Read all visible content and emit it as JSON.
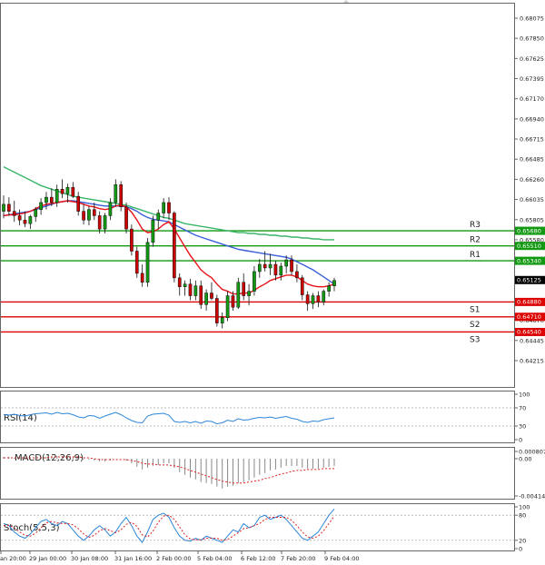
{
  "main": {
    "price_ticks": [
      "0.68075",
      "0.67850",
      "0.67625",
      "0.67395",
      "0.67170",
      "0.66940",
      "0.66715",
      "0.66485",
      "0.66260",
      "0.66035",
      "0.65805",
      "0.65580",
      "0.65350",
      "0.65125",
      "0.64900",
      "0.64670",
      "0.64445",
      "0.64215"
    ],
    "ylim": [
      0.64215,
      0.68075
    ],
    "current_price": "0.65125",
    "levels": [
      {
        "name": "R3",
        "value": 0.6568,
        "tag": "0.65680",
        "color": "#119911"
      },
      {
        "name": "R2",
        "value": 0.6551,
        "tag": "0.65510",
        "color": "#119911"
      },
      {
        "name": "R1",
        "value": 0.6534,
        "tag": "0.65340",
        "color": "#119911"
      },
      {
        "name": "S1",
        "value": 0.6488,
        "tag": "0.64880",
        "color": "#dd0000"
      },
      {
        "name": "S2",
        "value": 0.6471,
        "tag": "0.64710",
        "color": "#dd0000"
      },
      {
        "name": "S3",
        "value": 0.6454,
        "tag": "0.64540",
        "color": "#dd0000"
      }
    ],
    "colors": {
      "up": "#119911",
      "down": "#cc0000",
      "ma_fast": "#e8141a",
      "ma_mid": "#3a5fd8",
      "ma_slow": "#3ab56a",
      "current_tag": "#000000"
    }
  },
  "rsi": {
    "label": "RSI(14)",
    "ticks": [
      "100",
      "70",
      "30",
      "0"
    ],
    "line_color": "#2e86d9"
  },
  "macd": {
    "label": "MACD(12,26,9)",
    "ticks": [
      "0.000807",
      "0.00",
      "-0.004142"
    ],
    "hist_color": "#888888",
    "signal_color": "#dd2222"
  },
  "stoch": {
    "label": "Stoch(5,5,3)",
    "ticks": [
      "100",
      "80",
      "20",
      "0"
    ],
    "main_color": "#2e86d9",
    "signal_color": "#dd2222"
  },
  "time_axis": [
    "an 20:00",
    "29 Jan 00:00",
    "30 Jan 08:00",
    "31 Jan 16:00",
    "2 Feb 00:00",
    "5 Feb 04:00",
    "6 Feb 12:00",
    "7 Feb 20:00",
    "9 Feb 04:00"
  ],
  "chart_data": {
    "type": "candlestick",
    "x_labels": [
      "an 20:00",
      "29 Jan 00:00",
      "30 Jan 08:00",
      "31 Jan 16:00",
      "2 Feb 00:00",
      "5 Feb 04:00",
      "6 Feb 12:00",
      "7 Feb 20:00",
      "9 Feb 04:00"
    ],
    "ylim": [
      0.64215,
      0.68075
    ],
    "ohlc": [
      [
        0.659,
        0.6608,
        0.6582,
        0.6598
      ],
      [
        0.6598,
        0.6606,
        0.6585,
        0.659
      ],
      [
        0.659,
        0.6602,
        0.6578,
        0.6585
      ],
      [
        0.6585,
        0.6592,
        0.6574,
        0.658
      ],
      [
        0.658,
        0.659,
        0.6572,
        0.6576
      ],
      [
        0.6576,
        0.6586,
        0.657,
        0.6584
      ],
      [
        0.6584,
        0.6595,
        0.6578,
        0.6592
      ],
      [
        0.6592,
        0.6605,
        0.6586,
        0.66
      ],
      [
        0.66,
        0.6612,
        0.6592,
        0.6606
      ],
      [
        0.6606,
        0.6616,
        0.6596,
        0.66
      ],
      [
        0.66,
        0.662,
        0.6595,
        0.6615
      ],
      [
        0.6615,
        0.6626,
        0.6605,
        0.661
      ],
      [
        0.661,
        0.6621,
        0.66,
        0.6617
      ],
      [
        0.6617,
        0.6623,
        0.6605,
        0.6607
      ],
      [
        0.6607,
        0.6612,
        0.6585,
        0.659
      ],
      [
        0.659,
        0.6598,
        0.6575,
        0.658
      ],
      [
        0.658,
        0.6596,
        0.6574,
        0.6592
      ],
      [
        0.6592,
        0.66,
        0.658,
        0.6585
      ],
      [
        0.6585,
        0.659,
        0.6565,
        0.657
      ],
      [
        0.657,
        0.6588,
        0.6565,
        0.6585
      ],
      [
        0.6585,
        0.6605,
        0.658,
        0.66
      ],
      [
        0.66,
        0.6626,
        0.6595,
        0.662
      ],
      [
        0.662,
        0.6624,
        0.659,
        0.6595
      ],
      [
        0.6595,
        0.66,
        0.6565,
        0.657
      ],
      [
        0.657,
        0.6575,
        0.654,
        0.6545
      ],
      [
        0.6545,
        0.655,
        0.6515,
        0.652
      ],
      [
        0.652,
        0.653,
        0.6505,
        0.651
      ],
      [
        0.651,
        0.656,
        0.6505,
        0.6555
      ],
      [
        0.6555,
        0.6585,
        0.655,
        0.658
      ],
      [
        0.658,
        0.6592,
        0.657,
        0.6588
      ],
      [
        0.6588,
        0.6605,
        0.6582,
        0.66
      ],
      [
        0.66,
        0.6606,
        0.658,
        0.6588
      ],
      [
        0.6588,
        0.659,
        0.651,
        0.6515
      ],
      [
        0.6515,
        0.652,
        0.6495,
        0.6505
      ],
      [
        0.6505,
        0.6512,
        0.6495,
        0.6508
      ],
      [
        0.6508,
        0.6514,
        0.649,
        0.6495
      ],
      [
        0.6495,
        0.6512,
        0.649,
        0.6506
      ],
      [
        0.6506,
        0.6512,
        0.648,
        0.6485
      ],
      [
        0.6485,
        0.6502,
        0.6478,
        0.6498
      ],
      [
        0.6498,
        0.651,
        0.649,
        0.6492
      ],
      [
        0.6492,
        0.6496,
        0.646,
        0.6464
      ],
      [
        0.6464,
        0.6476,
        0.6458,
        0.647
      ],
      [
        0.647,
        0.65,
        0.6466,
        0.6495
      ],
      [
        0.6495,
        0.65,
        0.6478,
        0.6482
      ],
      [
        0.6482,
        0.6515,
        0.648,
        0.651
      ],
      [
        0.651,
        0.652,
        0.649,
        0.6495
      ],
      [
        0.6495,
        0.6508,
        0.6484,
        0.65
      ],
      [
        0.65,
        0.6528,
        0.6495,
        0.6522
      ],
      [
        0.6522,
        0.6536,
        0.6515,
        0.653
      ],
      [
        0.653,
        0.6545,
        0.6522,
        0.6526
      ],
      [
        0.6526,
        0.6542,
        0.6518,
        0.653
      ],
      [
        0.653,
        0.6534,
        0.6512,
        0.6518
      ],
      [
        0.6518,
        0.6532,
        0.6512,
        0.6528
      ],
      [
        0.6528,
        0.654,
        0.652,
        0.6535
      ],
      [
        0.6535,
        0.654,
        0.6518,
        0.6522
      ],
      [
        0.6522,
        0.653,
        0.651,
        0.6515
      ],
      [
        0.6515,
        0.6518,
        0.649,
        0.6496
      ],
      [
        0.6496,
        0.65,
        0.6478,
        0.6486
      ],
      [
        0.6486,
        0.6498,
        0.648,
        0.6495
      ],
      [
        0.6495,
        0.65,
        0.6482,
        0.6488
      ],
      [
        0.6488,
        0.6502,
        0.6484,
        0.65
      ],
      [
        0.65,
        0.651,
        0.6494,
        0.6506
      ],
      [
        0.6506,
        0.6515,
        0.65,
        0.6512
      ]
    ],
    "ma_fast": [
      0.6585,
      0.6586,
      0.6586,
      0.6587,
      0.6588,
      0.659,
      0.6593,
      0.6596,
      0.6598,
      0.6599,
      0.66,
      0.6601,
      0.6602,
      0.6601,
      0.66,
      0.6598,
      0.6596,
      0.6595,
      0.6593,
      0.6592,
      0.6593,
      0.6596,
      0.6597,
      0.6595,
      0.6589,
      0.658,
      0.657,
      0.6566,
      0.6567,
      0.657,
      0.6575,
      0.6578,
      0.657,
      0.656,
      0.655,
      0.654,
      0.6532,
      0.6524,
      0.6519,
      0.6515,
      0.6508,
      0.6502,
      0.65,
      0.6497,
      0.6497,
      0.6498,
      0.6498,
      0.6501,
      0.6505,
      0.6508,
      0.6512,
      0.6514,
      0.6516,
      0.6518,
      0.6518,
      0.6516,
      0.6512,
      0.6508,
      0.6506,
      0.6505,
      0.6505,
      0.6506,
      0.6508
    ],
    "ma_mid": [
      0.6585,
      0.6586,
      0.6587,
      0.6588,
      0.6589,
      0.659,
      0.6592,
      0.6594,
      0.6596,
      0.6598,
      0.66,
      0.6601,
      0.6602,
      0.6602,
      0.6601,
      0.66,
      0.6599,
      0.6598,
      0.6597,
      0.6596,
      0.6596,
      0.6596,
      0.6596,
      0.6595,
      0.6593,
      0.659,
      0.6586,
      0.6583,
      0.6581,
      0.658,
      0.6579,
      0.6578,
      0.6575,
      0.6572,
      0.6569,
      0.6566,
      0.6563,
      0.6561,
      0.6559,
      0.6557,
      0.6555,
      0.6553,
      0.6551,
      0.6549,
      0.6547,
      0.6546,
      0.6545,
      0.6544,
      0.6543,
      0.6542,
      0.6541,
      0.654,
      0.6539,
      0.6538,
      0.6536,
      0.6533,
      0.653,
      0.6527,
      0.6524,
      0.652,
      0.6516,
      0.6512,
      0.6508
    ],
    "ma_slow": [
      0.664,
      0.6637,
      0.6634,
      0.6631,
      0.6628,
      0.6625,
      0.6622,
      0.6619,
      0.6617,
      0.6615,
      0.6613,
      0.6611,
      0.6609,
      0.6607,
      0.6606,
      0.6605,
      0.6604,
      0.6603,
      0.6602,
      0.6601,
      0.66,
      0.6599,
      0.6598,
      0.6597,
      0.6595,
      0.6593,
      0.6591,
      0.6589,
      0.6587,
      0.6585,
      0.6583,
      0.6582,
      0.658,
      0.6578,
      0.6576,
      0.6575,
      0.6574,
      0.6573,
      0.6572,
      0.6571,
      0.657,
      0.6569,
      0.6568,
      0.6567,
      0.6566,
      0.6566,
      0.6565,
      0.6565,
      0.6564,
      0.6564,
      0.6563,
      0.6563,
      0.6562,
      0.6562,
      0.6561,
      0.6561,
      0.656,
      0.656,
      0.6559,
      0.6559,
      0.6558,
      0.6558,
      0.6558
    ],
    "rsi": [
      55,
      54,
      56,
      53,
      52,
      55,
      57,
      58,
      59,
      56,
      60,
      57,
      58,
      55,
      50,
      48,
      53,
      52,
      47,
      52,
      56,
      60,
      55,
      48,
      42,
      38,
      37,
      52,
      56,
      57,
      58,
      54,
      40,
      38,
      40,
      37,
      40,
      36,
      41,
      40,
      35,
      37,
      43,
      40,
      46,
      43,
      44,
      47,
      49,
      48,
      50,
      47,
      49,
      51,
      47,
      45,
      40,
      38,
      41,
      40,
      44,
      46,
      48
    ],
    "macd_hist": [
      0.0002,
      0.0002,
      0.0001,
      0.0001,
      0.0,
      0.0,
      0.0001,
      0.0002,
      0.0002,
      0.0002,
      0.0003,
      0.0003,
      0.0003,
      0.0002,
      0.0001,
      -0.0001,
      -0.0001,
      -0.0002,
      -0.0003,
      -0.0003,
      -0.0002,
      0.0,
      0.0,
      -0.0002,
      -0.0005,
      -0.0009,
      -0.0012,
      -0.001,
      -0.0008,
      -0.0007,
      -0.0005,
      -0.0005,
      -0.001,
      -0.0015,
      -0.0018,
      -0.0021,
      -0.0023,
      -0.0026,
      -0.0027,
      -0.0028,
      -0.0031,
      -0.0033,
      -0.0031,
      -0.003,
      -0.0027,
      -0.0026,
      -0.0024,
      -0.0021,
      -0.0018,
      -0.0016,
      -0.0013,
      -0.0012,
      -0.001,
      -0.0008,
      -0.0008,
      -0.0008,
      -0.001,
      -0.0011,
      -0.0011,
      -0.0011,
      -0.001,
      -0.0009,
      -0.0008
    ],
    "macd_signal": [
      0.0001,
      0.0001,
      0.0001,
      0.0001,
      0.0001,
      0.0001,
      0.0001,
      0.0001,
      0.0001,
      0.0002,
      0.0002,
      0.0002,
      0.0002,
      0.0002,
      0.0002,
      0.0001,
      0.0001,
      0.0,
      -0.0001,
      -0.0001,
      -0.0001,
      -0.0001,
      -0.0001,
      -0.0001,
      -0.0002,
      -0.0003,
      -0.0005,
      -0.0006,
      -0.0006,
      -0.0007,
      -0.0007,
      -0.0007,
      -0.0008,
      -0.0009,
      -0.0011,
      -0.0013,
      -0.0015,
      -0.0017,
      -0.0019,
      -0.0021,
      -0.0023,
      -0.0025,
      -0.0026,
      -0.0027,
      -0.0027,
      -0.0027,
      -0.0026,
      -0.0025,
      -0.0024,
      -0.0022,
      -0.0021,
      -0.0019,
      -0.0017,
      -0.0016,
      -0.0014,
      -0.0013,
      -0.0013,
      -0.0012,
      -0.0012,
      -0.0012,
      -0.0011,
      -0.0011,
      -0.0011
    ],
    "stoch_main": [
      60,
      55,
      40,
      30,
      25,
      35,
      50,
      65,
      70,
      60,
      55,
      65,
      60,
      45,
      30,
      20,
      30,
      45,
      55,
      45,
      30,
      40,
      60,
      75,
      55,
      30,
      15,
      40,
      70,
      80,
      85,
      75,
      50,
      30,
      20,
      18,
      25,
      20,
      30,
      25,
      20,
      15,
      30,
      45,
      40,
      60,
      50,
      55,
      75,
      80,
      70,
      75,
      80,
      70,
      55,
      40,
      25,
      20,
      30,
      40,
      60,
      80,
      95
    ],
    "stoch_signal": [
      55,
      56,
      50,
      40,
      32,
      30,
      37,
      50,
      62,
      65,
      62,
      60,
      60,
      57,
      48,
      35,
      27,
      32,
      43,
      48,
      43,
      38,
      45,
      58,
      63,
      53,
      33,
      28,
      42,
      63,
      78,
      80,
      70,
      52,
      33,
      23,
      21,
      21,
      25,
      25,
      25,
      20,
      22,
      30,
      38,
      48,
      50,
      55,
      60,
      70,
      75,
      75,
      75,
      75,
      68,
      55,
      40,
      28,
      25,
      30,
      43,
      60,
      78
    ]
  }
}
